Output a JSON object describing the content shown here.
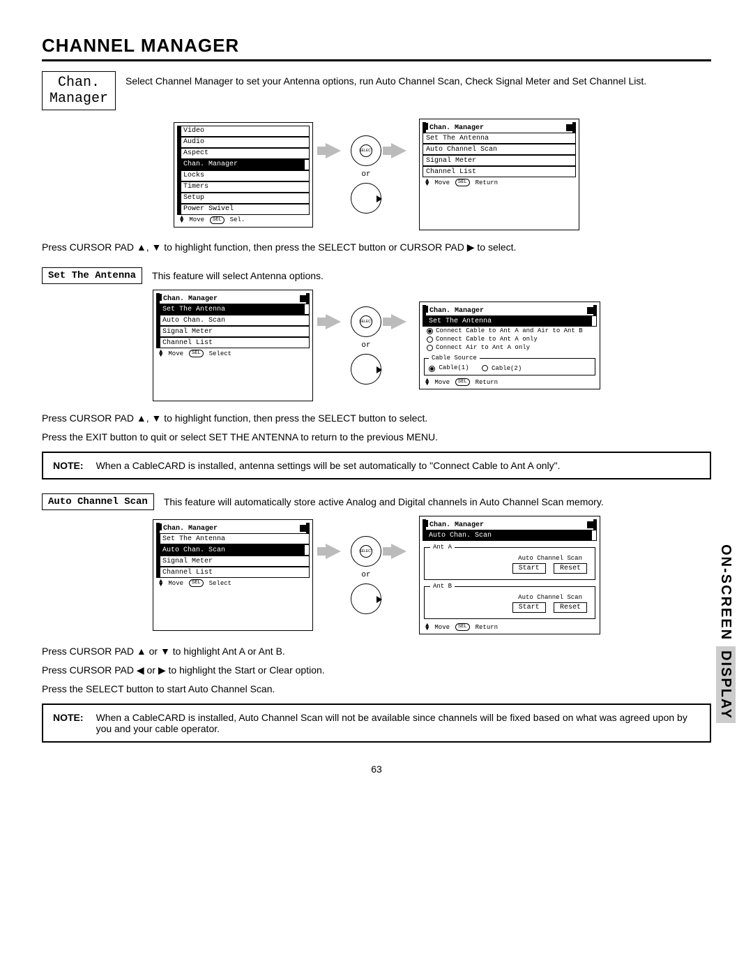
{
  "page_title": "CHANNEL MANAGER",
  "side_tab_plain": "ON-SCREEN",
  "side_tab_shaded": "DISPLAY",
  "page_number": "63",
  "intro": {
    "box": "Chan.\nManager",
    "text": "Select Channel Manager to set your Antenna options, run Auto Channel Scan, Check Signal Meter and Set Channel List."
  },
  "main_menu": {
    "items": [
      "Video",
      "Audio",
      "Aspect",
      "Chan. Manager",
      "Locks",
      "Timers",
      "Setup",
      "Power Swivel"
    ],
    "selected": "Chan. Manager",
    "footer_move": "Move",
    "footer_sel": "SEL",
    "footer_action": "Sel."
  },
  "chan_manager_menu": {
    "header": "Chan. Manager",
    "items": [
      "Set The Antenna",
      "Auto Channel Scan",
      "Signal Meter",
      "Channel List"
    ],
    "footer_move": "Move",
    "footer_sel": "SEL",
    "footer_action": "Return"
  },
  "instruction1": "Press CURSOR PAD ▲, ▼ to highlight function, then press the SELECT button or CURSOR PAD ▶ to select.",
  "set_antenna": {
    "box": "Set The Antenna",
    "text": "This feature will select Antenna options.",
    "left_menu": {
      "header": "Chan. Manager",
      "items": [
        "Set The Antenna",
        "Auto Chan. Scan",
        "Signal Meter",
        "Channel List"
      ],
      "selected": "Set The Antenna",
      "footer_move": "Move",
      "footer_sel": "SEL",
      "footer_action": "Select"
    },
    "right_panel": {
      "header": "Chan. Manager",
      "selected_row": "Set The Antenna",
      "opts": [
        "Connect Cable to Ant A and Air to Ant B",
        "Connect Cable to Ant A only",
        "Connect Air to Ant A only"
      ],
      "opt_selected_index": 0,
      "fieldset_legend": "Cable Source",
      "cable1": "Cable(1)",
      "cable2": "Cable(2)",
      "footer_move": "Move",
      "footer_sel": "SEL",
      "footer_action": "Return"
    },
    "instr_a": "Press CURSOR PAD ▲, ▼ to highlight function, then press the SELECT button to select.",
    "instr_b": "Press the EXIT button to quit or select SET THE ANTENNA to return to the previous MENU.",
    "note_label": "NOTE:",
    "note_body": "When a CableCARD is installed, antenna settings will be set automatically to \"Connect Cable to Ant A only\"."
  },
  "auto_scan": {
    "box": "Auto Channel Scan",
    "text": "This feature will automatically store active Analog and Digital channels in Auto Channel Scan memory.",
    "left_menu": {
      "header": "Chan. Manager",
      "items": [
        "Set The Antenna",
        "Auto Chan. Scan",
        "Signal Meter",
        "Channel List"
      ],
      "selected": "Auto Chan. Scan",
      "footer_move": "Move",
      "footer_sel": "SEL",
      "footer_action": "Select"
    },
    "right_panel": {
      "header": "Chan. Manager",
      "selected_row": "Auto Chan. Scan",
      "antA_legend": "Ant A",
      "antB_legend": "Ant B",
      "ant_label": "Auto Channel Scan",
      "btn_start": "Start",
      "btn_reset": "Reset",
      "footer_move": "Move",
      "footer_sel": "SEL",
      "footer_action": "Return"
    },
    "instr_a": "Press CURSOR PAD ▲ or ▼ to highlight Ant A or Ant B.",
    "instr_b": "Press CURSOR PAD ◀ or ▶ to highlight the Start or Clear option.",
    "instr_c": "Press the SELECT button to start Auto Channel Scan.",
    "note_label": "NOTE:",
    "note_body": "When a CableCARD is installed, Auto Channel Scan will not be available since channels will be fixed based on what was agreed upon by you and your cable operator."
  },
  "or_label": "or"
}
